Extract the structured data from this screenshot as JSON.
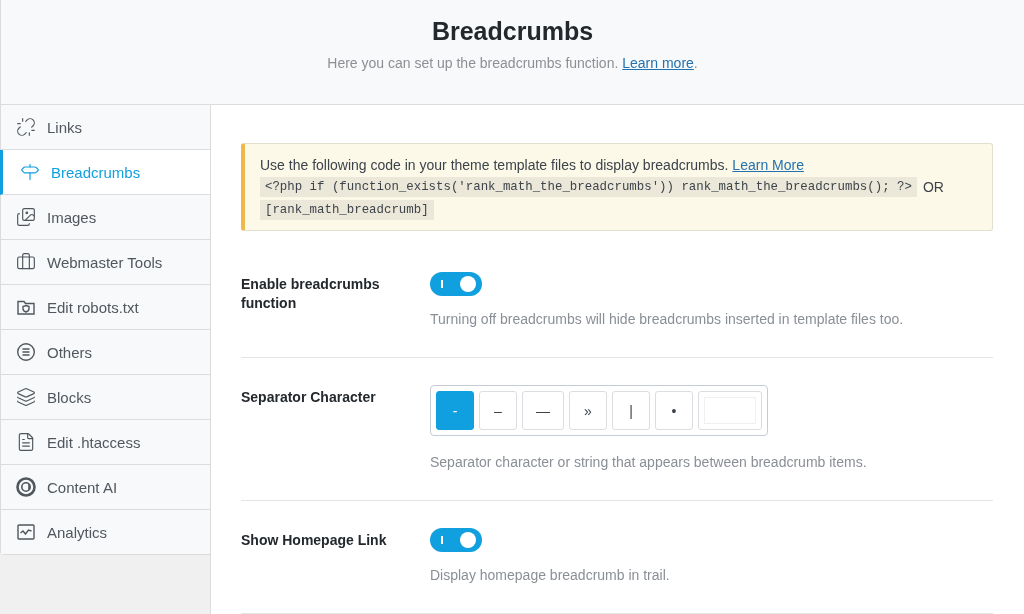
{
  "header": {
    "title": "Breadcrumbs",
    "description": "Here you can set up the breadcrumbs function.",
    "link": "Learn more",
    "end": "."
  },
  "sidebar": {
    "items": [
      {
        "label": "Links",
        "selected": false
      },
      {
        "label": "Breadcrumbs",
        "selected": true
      },
      {
        "label": "Images",
        "selected": false
      },
      {
        "label": "Webmaster Tools",
        "selected": false
      },
      {
        "label": "Edit robots.txt",
        "selected": false
      },
      {
        "label": "Others",
        "selected": false
      },
      {
        "label": "Blocks",
        "selected": false
      },
      {
        "label": "Edit .htaccess",
        "selected": false
      },
      {
        "label": "Content AI",
        "selected": false
      },
      {
        "label": "Analytics",
        "selected": false
      }
    ]
  },
  "notice": {
    "text": "Use the following code in your theme template files to display breadcrumbs.",
    "link": "Learn More",
    "code": "<?php if (function_exists('rank_math_the_breadcrumbs')) rank_math_the_breadcrumbs(); ?>",
    "or": "OR",
    "shortcode": "[rank_math_breadcrumb]"
  },
  "settings": [
    {
      "kind": "toggle",
      "label": "Enable breadcrumbs function",
      "on": true,
      "description": "Turning off breadcrumbs will hide breadcrumbs inserted in template files too."
    },
    {
      "kind": "separator",
      "label": "Separator Character",
      "options": [
        {
          "label": "-",
          "selected": true
        },
        {
          "label": "–",
          "selected": false
        },
        {
          "label": "—",
          "selected": false
        },
        {
          "label": "»",
          "selected": false
        },
        {
          "label": "|",
          "selected": false
        },
        {
          "label": "•",
          "selected": false
        }
      ],
      "description": "Separator character or string that appears between breadcrumb items."
    },
    {
      "kind": "toggle",
      "label": "Show Homepage Link",
      "on": true,
      "description": "Display homepage breadcrumb in trail."
    }
  ]
}
